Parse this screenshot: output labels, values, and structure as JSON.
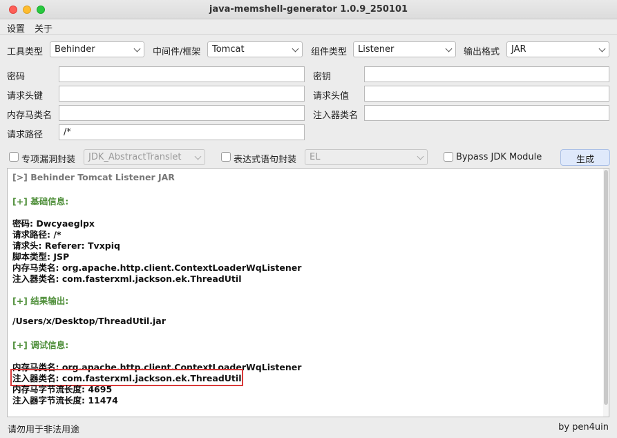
{
  "window": {
    "title": "java-memshell-generator 1.0.9_250101"
  },
  "menu": {
    "settings": "设置",
    "about": "关于"
  },
  "selectors": {
    "tool_label": "工具类型",
    "tool_value": "Behinder",
    "middleware_label": "中间件/框架",
    "middleware_value": "Tomcat",
    "component_label": "组件类型",
    "component_value": "Listener",
    "format_label": "输出格式",
    "format_value": "JAR"
  },
  "fields": {
    "password_label": "密码",
    "password_value": "",
    "key_label": "密钥",
    "key_value": "",
    "header_key_label": "请求头键",
    "header_key_value": "",
    "header_value_label": "请求头值",
    "header_value_value": "",
    "shell_class_label": "内存马类名",
    "shell_class_value": "",
    "injector_class_label": "注入器类名",
    "injector_class_value": "",
    "path_label": "请求路径",
    "path_value": "/*"
  },
  "options": {
    "gadget_label": "专项漏洞封装",
    "gadget_value": "JDK_AbstractTranslet",
    "gadget_checked": false,
    "expr_label": "表达式语句封装",
    "expr_value": "EL",
    "expr_checked": false,
    "bypass_label": "Bypass JDK Module",
    "bypass_checked": false,
    "generate_label": "生成"
  },
  "output": {
    "header": "[>] Behinder Tomcat Listener JAR",
    "basic_section": "[+] 基础信息:",
    "basic_lines": [
      "密码: Dwcyaeglpx",
      "请求路径: /*",
      "请求头: Referer: Tvxpiq",
      "脚本类型: JSP",
      "内存马类名: org.apache.http.client.ContextLoaderWqListener",
      "注入器类名: com.fasterxml.jackson.ek.ThreadUtil"
    ],
    "result_section": "[+] 结果输出:",
    "result_path": "/Users/x/Desktop/ThreadUtil.jar",
    "debug_section": "[+] 调试信息:",
    "debug_lines": [
      "内存马类名: org.apache.http.client.ContextLoaderWqListener",
      "注入器类名: com.fasterxml.jackson.ek.ThreadUtil",
      "内存马字节流长度: 4695",
      "注入器字节流长度: 11474"
    ],
    "highlighted_line_index": 1,
    "highlight_color": "#d93a3a"
  },
  "status": {
    "left": "请勿用于非法用途",
    "right": "by pen4uin"
  }
}
